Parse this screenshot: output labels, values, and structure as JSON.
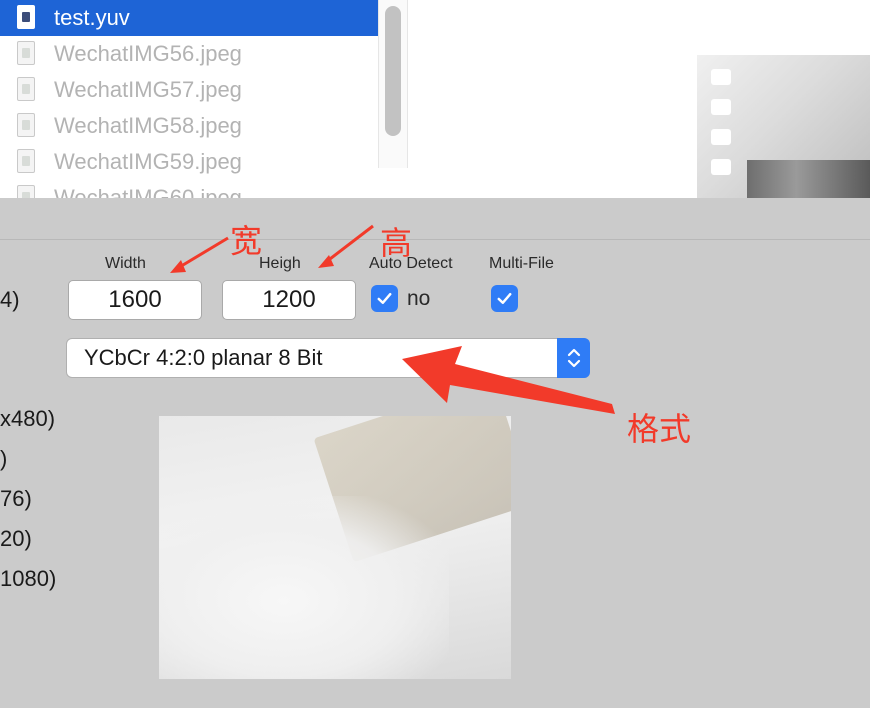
{
  "file_browser": {
    "files": [
      {
        "name": "test.yuv",
        "selected": true
      },
      {
        "name": "WechatIMG56.jpeg",
        "selected": false
      },
      {
        "name": "WechatIMG57.jpeg",
        "selected": false
      },
      {
        "name": "WechatIMG58.jpeg",
        "selected": false
      },
      {
        "name": "WechatIMG59.jpeg",
        "selected": false
      },
      {
        "name": "WechatIMG60.jpeg",
        "selected": false
      }
    ]
  },
  "settings": {
    "width_label": "Width",
    "height_label": "Heigh",
    "auto_detect_label": "Auto Detect",
    "multi_file_label": "Multi-File",
    "width_value": "1600",
    "height_value": "1200",
    "auto_detect_checked": true,
    "auto_detect_result": "no",
    "multi_file_checked": true,
    "left_clip": "4)",
    "format_value": "YCbCr 4:2:0 planar 8 Bit"
  },
  "size_list": [
    "x480)",
    ")",
    "76)",
    "20)",
    "1080)"
  ],
  "annotations": {
    "width_note": "宽",
    "height_note": "高",
    "format_note": "格式",
    "color": "#f23a2a"
  },
  "colors": {
    "accent": "#2f7cf6",
    "selection": "#1e64d6",
    "dialog_bg": "#cbcbcb"
  }
}
